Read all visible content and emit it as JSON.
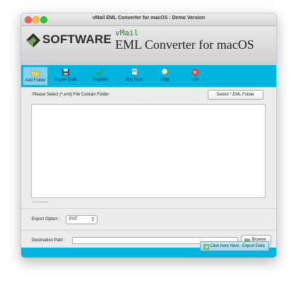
{
  "window": {
    "title": "vMail EML Converter for macOS : Demo Version"
  },
  "banner": {
    "logo_text": "SOFTWARE",
    "product_small": "vMail",
    "product_large": "EML Converter for macOS"
  },
  "toolbar": {
    "items": [
      {
        "label": "Add Folder",
        "icon": "folder-icon",
        "active": true
      },
      {
        "label": "Export Data",
        "icon": "disk-icon",
        "active": false
      },
      {
        "label": "Register",
        "icon": "checkmark-icon",
        "active": false
      },
      {
        "label": "Buy Now",
        "icon": "cart-icon",
        "active": false
      },
      {
        "label": "Help",
        "icon": "lightbulb-icon",
        "active": false
      },
      {
        "label": "Exit",
        "icon": "exit-icon",
        "active": false
      }
    ]
  },
  "main": {
    "prompt": "Please Select (*.eml) File Contain Folder",
    "select_button": "Select *.EML Folder",
    "status_text": "-----------"
  },
  "export": {
    "label": "Export Option :",
    "selected": "PST"
  },
  "destination": {
    "label": "Destination Path :",
    "value": "",
    "browse_label": "Browse"
  },
  "footer": {
    "next_button": "Click here Next.. Export Data"
  },
  "colors": {
    "accent": "#00b4e0",
    "logo_green": "#6aa84f",
    "logo_dark": "#2b2b2b"
  }
}
